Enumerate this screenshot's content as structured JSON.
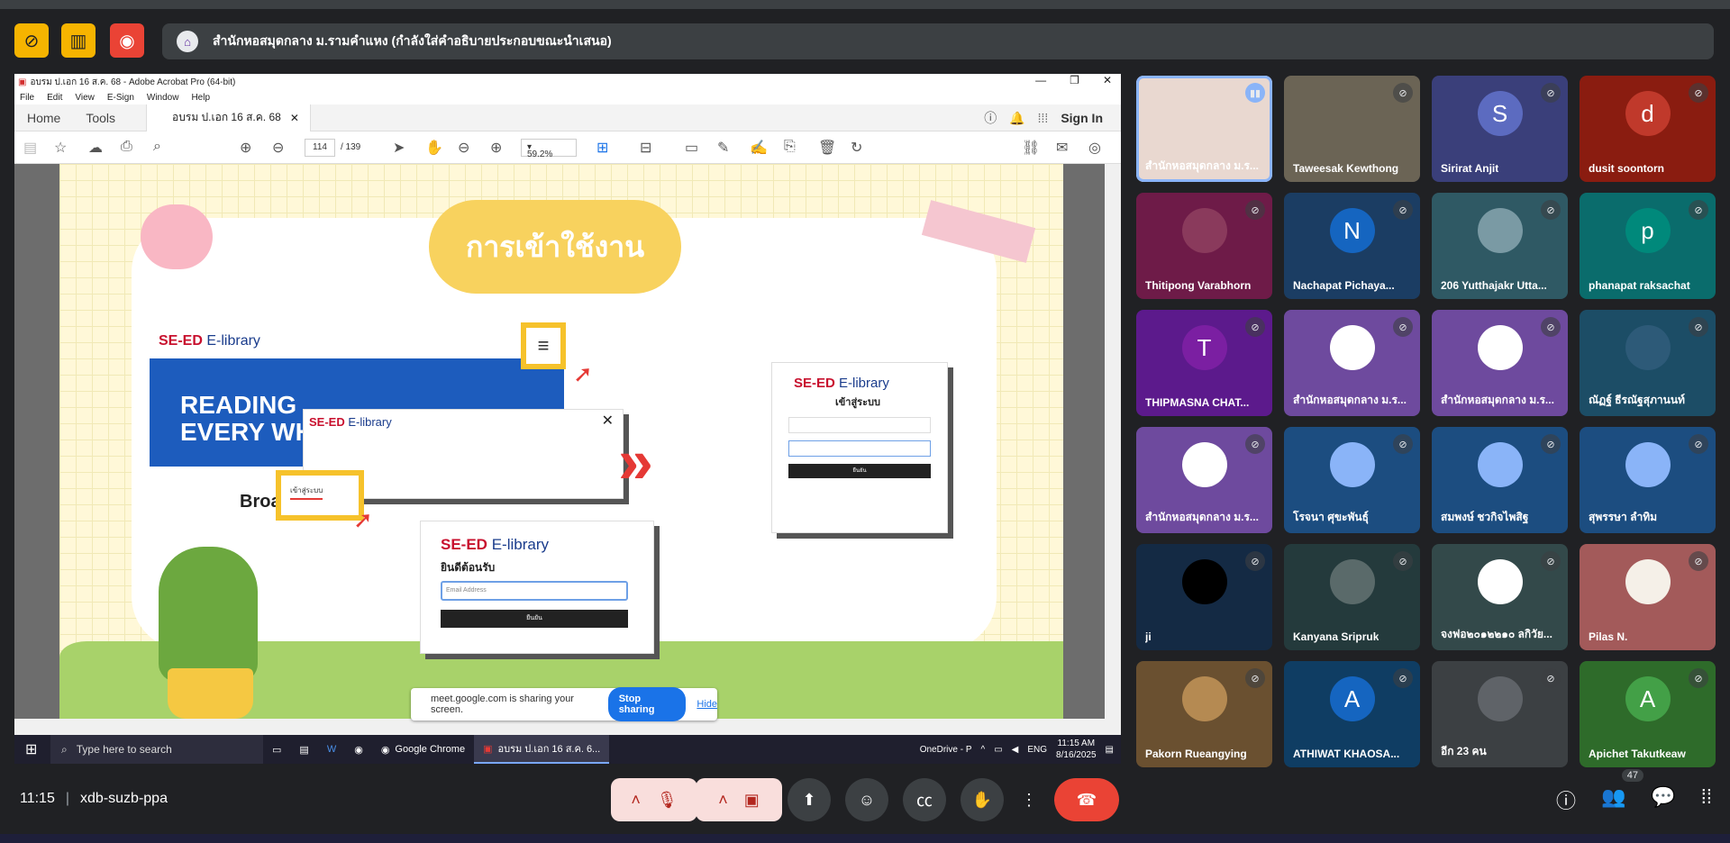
{
  "banner": {
    "presenter_text": "สำนักหอสมุดกลาง ม.รามคำแหง (กำลังใส่คำอธิบายประกอบขณะนำเสนอ)"
  },
  "acrobat": {
    "title": "อบรม ป.เอก 16 ส.ค. 68 - Adobe Acrobat Pro (64-bit)",
    "menu": [
      "File",
      "Edit",
      "View",
      "E-Sign",
      "Window",
      "Help"
    ],
    "tabs": {
      "home": "Home",
      "tools": "Tools",
      "doc": "อบรม ป.เอก 16 ส.ค. 68"
    },
    "sign_in": "Sign In",
    "page_current": "114",
    "page_total": "/ 139",
    "zoom": "59.2%"
  },
  "slide": {
    "title": "การเข้าใช้งาน",
    "brand_red": "SE-ED",
    "brand_blue": " E-library",
    "reading": "READING",
    "every": "EVERY WH",
    "broad": "Broad",
    "welcome": "ยินดีต้อนรับ",
    "email_placeholder": "Email Address",
    "submit": "ยืนยัน",
    "login_title": "เข้าสู่ระบบ",
    "login_btn": "ยืนยัน",
    "menu_item": "เข้าสู่ระบบ"
  },
  "share": {
    "message": "meet.google.com is sharing your screen.",
    "stop": "Stop sharing",
    "hide": "Hide"
  },
  "taskbar": {
    "search": "Type here to search",
    "chrome": "Google Chrome",
    "acro": "อบรม ป.เอก 16 ส.ค. 6...",
    "onedrive": "OneDrive - P",
    "lang": "ENG",
    "time": "11:15 AM",
    "date": "8/16/2025"
  },
  "participants": [
    {
      "name": "สำนักหอสมุดกลาง ม.ร...",
      "bg": "#e9d8d0",
      "initial": "",
      "speaking": true
    },
    {
      "name": "Taweesak Kewthong",
      "bg": "#6b6455",
      "initial": ""
    },
    {
      "name": "Sirirat Anjit",
      "bg": "#3a3f7a",
      "initial": "S",
      "avatar_bg": "#5c6bc0"
    },
    {
      "name": "dusit soontorn",
      "bg": "#8a1c10",
      "initial": "d",
      "avatar_bg": "#c0392b"
    },
    {
      "name": "Thitipong Varabhorn",
      "bg": "#6e1b48",
      "initial": "",
      "avatar_bg": "#8a3a5c"
    },
    {
      "name": "Nachapat Pichaya...",
      "bg": "#1b3d63",
      "initial": "N",
      "avatar_bg": "#1565c0"
    },
    {
      "name": "206 Yutthajakr Utta...",
      "bg": "#2f5964",
      "initial": "",
      "avatar_bg": "#7a9aa4"
    },
    {
      "name": "phanapat raksachat",
      "bg": "#0a6c6c",
      "initial": "p",
      "avatar_bg": "#00897b"
    },
    {
      "name": "THIPMASNA CHAT...",
      "bg": "#5c1a8c",
      "initial": "T",
      "avatar_bg": "#7b1fa2"
    },
    {
      "name": "สำนักหอสมุดกลาง ม.ร...",
      "bg": "#6e4a9e",
      "initial": "",
      "avatar_bg": "#ffffff"
    },
    {
      "name": "สำนักหอสมุดกลาง ม.ร...",
      "bg": "#6e4a9e",
      "initial": "",
      "avatar_bg": "#ffffff"
    },
    {
      "name": "ณัฏฐ์ ธีรณัฐสุภานนท์",
      "bg": "#1c4d66",
      "initial": "",
      "avatar_bg": "#2d5a78"
    },
    {
      "name": "สำนักหอสมุดกลาง ม.ร...",
      "bg": "#6e4a9e",
      "initial": "",
      "avatar_bg": "#ffffff"
    },
    {
      "name": "โรจนา ศุขะพันธุ์",
      "bg": "#1c4d80",
      "initial": "",
      "avatar_bg": "#8ab4f8"
    },
    {
      "name": "สมพงษ์ ชวกิจไพสิฐ",
      "bg": "#1c4d80",
      "initial": "",
      "avatar_bg": "#8ab4f8"
    },
    {
      "name": "สุพรรษา ลำทิม",
      "bg": "#1c4d80",
      "initial": "",
      "avatar_bg": "#8ab4f8"
    },
    {
      "name": "ji",
      "bg": "#142a44",
      "initial": "",
      "avatar_bg": "#000000"
    },
    {
      "name": "Kanyana Sripruk",
      "bg": "#243a3c",
      "initial": "",
      "avatar_bg": "#5a6a6a"
    },
    {
      "name": "จงฟอ๒๐๑๒๒๑๐ ลกิวัย...",
      "bg": "#33494a",
      "initial": "",
      "avatar_bg": "#ffffff"
    },
    {
      "name": "Pilas N.",
      "bg": "#a35a5a",
      "initial": "",
      "avatar_bg": "#f5f0e8"
    },
    {
      "name": "Pakorn Rueangying",
      "bg": "#6a5030",
      "initial": "",
      "avatar_bg": "#b58a52"
    },
    {
      "name": "ATHIWAT KHAOSA...",
      "bg": "#0f3d63",
      "initial": "A",
      "avatar_bg": "#1565c0"
    },
    {
      "name": "อีก 23 คน",
      "bg": "#3c4043",
      "initial": "",
      "avatar_bg": "#5f6368"
    },
    {
      "name": "Apichet Takutkeaw",
      "bg": "#2e6b2a",
      "initial": "A",
      "avatar_bg": "#43a047"
    }
  ],
  "bottom": {
    "time": "11:15",
    "meeting_code": "xdb-suzb-ppa",
    "participant_count": "47"
  },
  "colors": {
    "end_call": "#ea4335",
    "muted": "#f9dedc",
    "accent": "#1a73e8"
  }
}
